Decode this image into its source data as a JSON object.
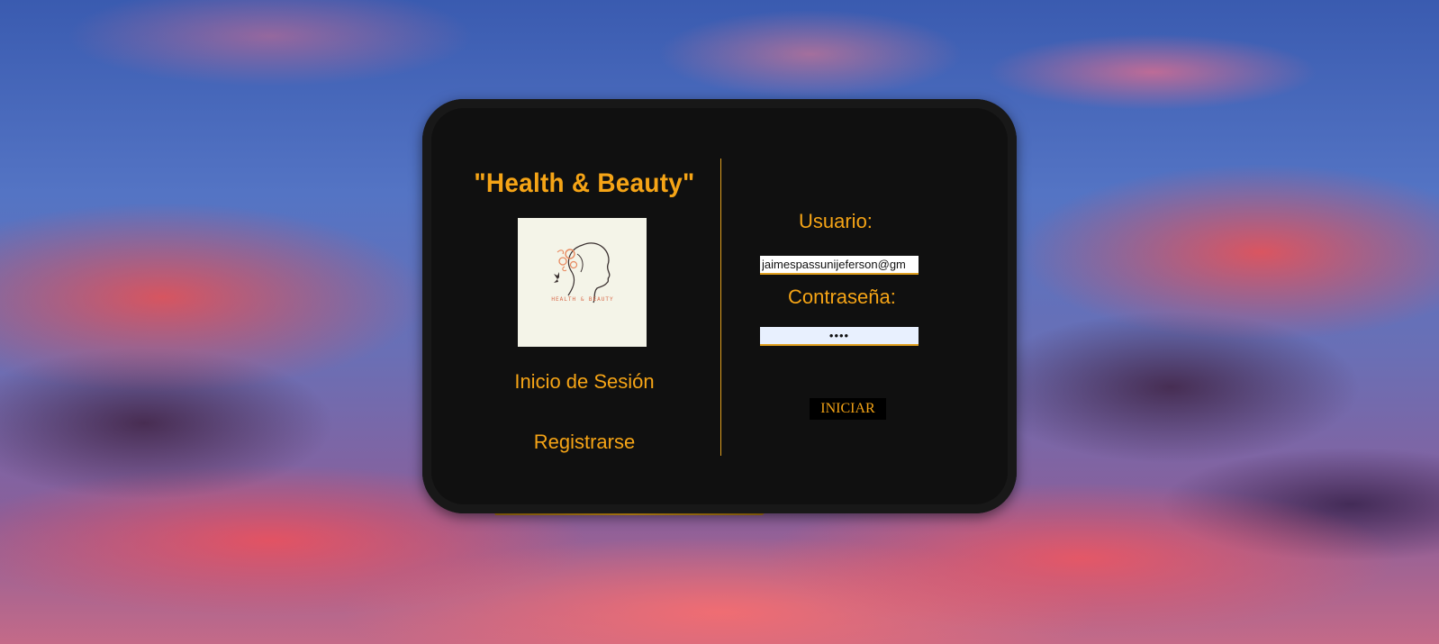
{
  "brand": {
    "title": "\"Health & Beauty\"",
    "logo_icon": "woman-face-butterfly-logo",
    "logo_caption": "HEALTH & BEAUTY"
  },
  "nav": {
    "login_label": "Inicio de Sesión",
    "register_label": "Registrarse"
  },
  "form": {
    "user_label": "Usuario:",
    "user_value": "jaimespassunijeferson@gm",
    "password_label": "Contraseña:",
    "password_value": "••••",
    "submit_label": "INICIAR"
  },
  "colors": {
    "accent": "#f5a416",
    "card": "#101010"
  }
}
